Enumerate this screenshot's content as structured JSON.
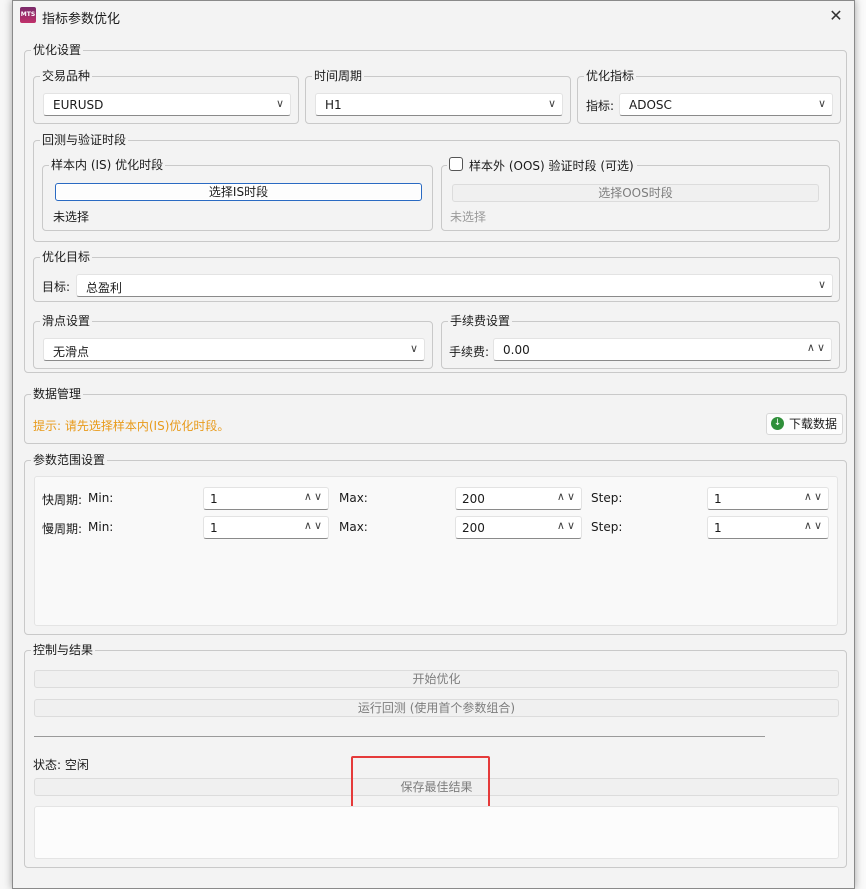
{
  "window": {
    "title": "指标参数优化",
    "icon_text": "MTS",
    "close_glyph": "✕"
  },
  "optimize_settings": {
    "legend": "优化设置",
    "symbol": {
      "legend": "交易品种",
      "value": "EURUSD"
    },
    "period": {
      "legend": "时间周期",
      "value": "H1"
    },
    "indicator": {
      "legend": "优化指标",
      "label": "指标:",
      "value": "ADOSC"
    },
    "backtest": {
      "legend": "回测与验证时段",
      "is": {
        "legend": "样本内 (IS) 优化时段",
        "button": "选择IS时段",
        "status": "未选择"
      },
      "oos": {
        "legend": "样本外 (OOS) 验证时段 (可选)",
        "button": "选择OOS时段",
        "status": "未选择",
        "checked": false
      }
    },
    "target": {
      "legend": "优化目标",
      "label": "目标:",
      "value": "总盈利"
    },
    "slippage": {
      "legend": "滑点设置",
      "value": "无滑点"
    },
    "fee": {
      "legend": "手续费设置",
      "label": "手续费:",
      "value": "0.00"
    }
  },
  "data_mgmt": {
    "legend": "数据管理",
    "hint": "提示: 请先选择样本内(IS)优化时段。",
    "download": "下载数据"
  },
  "param_range": {
    "legend": "参数范围设置",
    "rows": [
      {
        "name": "快周期:",
        "min_label": "Min:",
        "min": "1",
        "max_label": "Max:",
        "max": "200",
        "step_label": "Step:",
        "step": "1"
      },
      {
        "name": "慢周期:",
        "min_label": "Min:",
        "min": "1",
        "max_label": "Max:",
        "max": "200",
        "step_label": "Step:",
        "step": "1"
      }
    ]
  },
  "control": {
    "legend": "控制与结果",
    "start": "开始优化",
    "run_backtest": "运行回测 (使用首个参数组合)",
    "status": "状态: 空闲",
    "save": "保存最佳结果"
  },
  "icons": {
    "chevron": "∨",
    "spin": "∧∨"
  },
  "colors": {
    "accent": "#2a6ac2",
    "warning": "#e89a1a",
    "highlight": "#e53a3a",
    "download": "#2f8f3a"
  }
}
